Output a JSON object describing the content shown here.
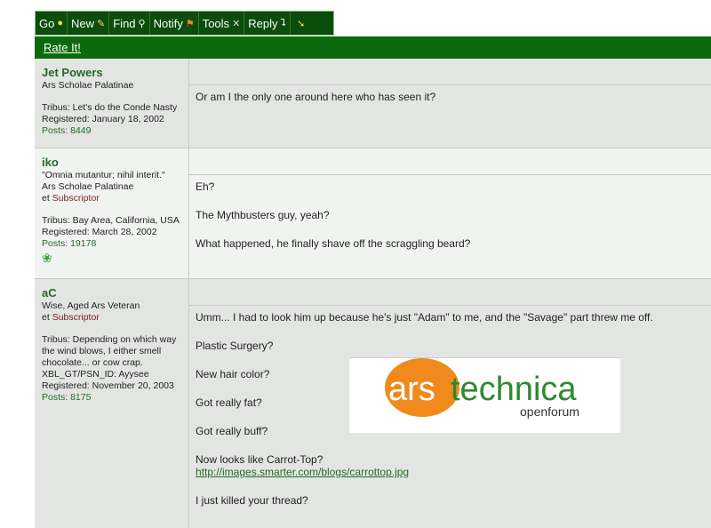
{
  "toolbar": {
    "items": [
      {
        "label": "Go",
        "icon": "globe-icon"
      },
      {
        "label": "New",
        "icon": "pencil-icon"
      },
      {
        "label": "Find",
        "icon": "magnifier-icon"
      },
      {
        "label": "Notify",
        "icon": "flag-icon"
      },
      {
        "label": "Tools",
        "icon": "wrench-icon"
      },
      {
        "label": "Reply",
        "icon": "reply-arrow-icon"
      },
      {
        "label": "",
        "icon": "down-arrow-icon"
      }
    ]
  },
  "rate": {
    "label": "Rate It!"
  },
  "posts": [
    {
      "username": "Jet Powers",
      "title": "Ars Scholae Palatinae",
      "tribus": "Tribus: Let's do the Conde Nasty",
      "registered": "Registered: January 18, 2002",
      "posts": "Posts: 8449",
      "lines": [
        "Or am I the only one around here who has seen it?"
      ]
    },
    {
      "username": "iko",
      "motto": "\"Omnia mutantur; nihil interit.\"",
      "title": "Ars Scholae Palatinae",
      "subscriber_prefix": "et ",
      "subscriber": "Subscriptor",
      "tribus": "Tribus: Bay Area, California, USA",
      "registered": "Registered: March 28, 2002",
      "posts": "Posts: 19178",
      "lines": [
        "Eh?",
        "The Mythbusters guy, yeah?",
        "What happened, he finally shave off the scraggling beard?"
      ]
    },
    {
      "username": "aC",
      "title": "Wise, Aged Ars Veteran",
      "subscriber_prefix": "et ",
      "subscriber": "Subscriptor",
      "tribus": "Tribus: Depending on which way the wind blows, I either smell chocolate... or cow crap. XBL_GT/PSN_ID: Ayysee",
      "registered": "Registered: November 20, 2003",
      "posts": "Posts: 8175",
      "lines": [
        "Umm... I had to look him up because he's just \"Adam\" to me, and the \"Savage\" part threw me off.",
        "Plastic Surgery?",
        "New hair color?",
        "Got really fat?",
        "Got really buff?",
        "Now looks like Carrot-Top?"
      ],
      "link": "http://images.smarter.com/blogs/carrottop.jpg",
      "last_line": "I just killed your thread?"
    }
  ],
  "logo": {
    "ars": "ars",
    "technica": "technica",
    "sub": "openforum"
  },
  "colors": {
    "toolbar": "#0b4d0b",
    "ratebar": "#0b6a0b",
    "username": "#226b22",
    "subscriber": "#7a1f1f",
    "logo_orange": "#f08a1c"
  }
}
